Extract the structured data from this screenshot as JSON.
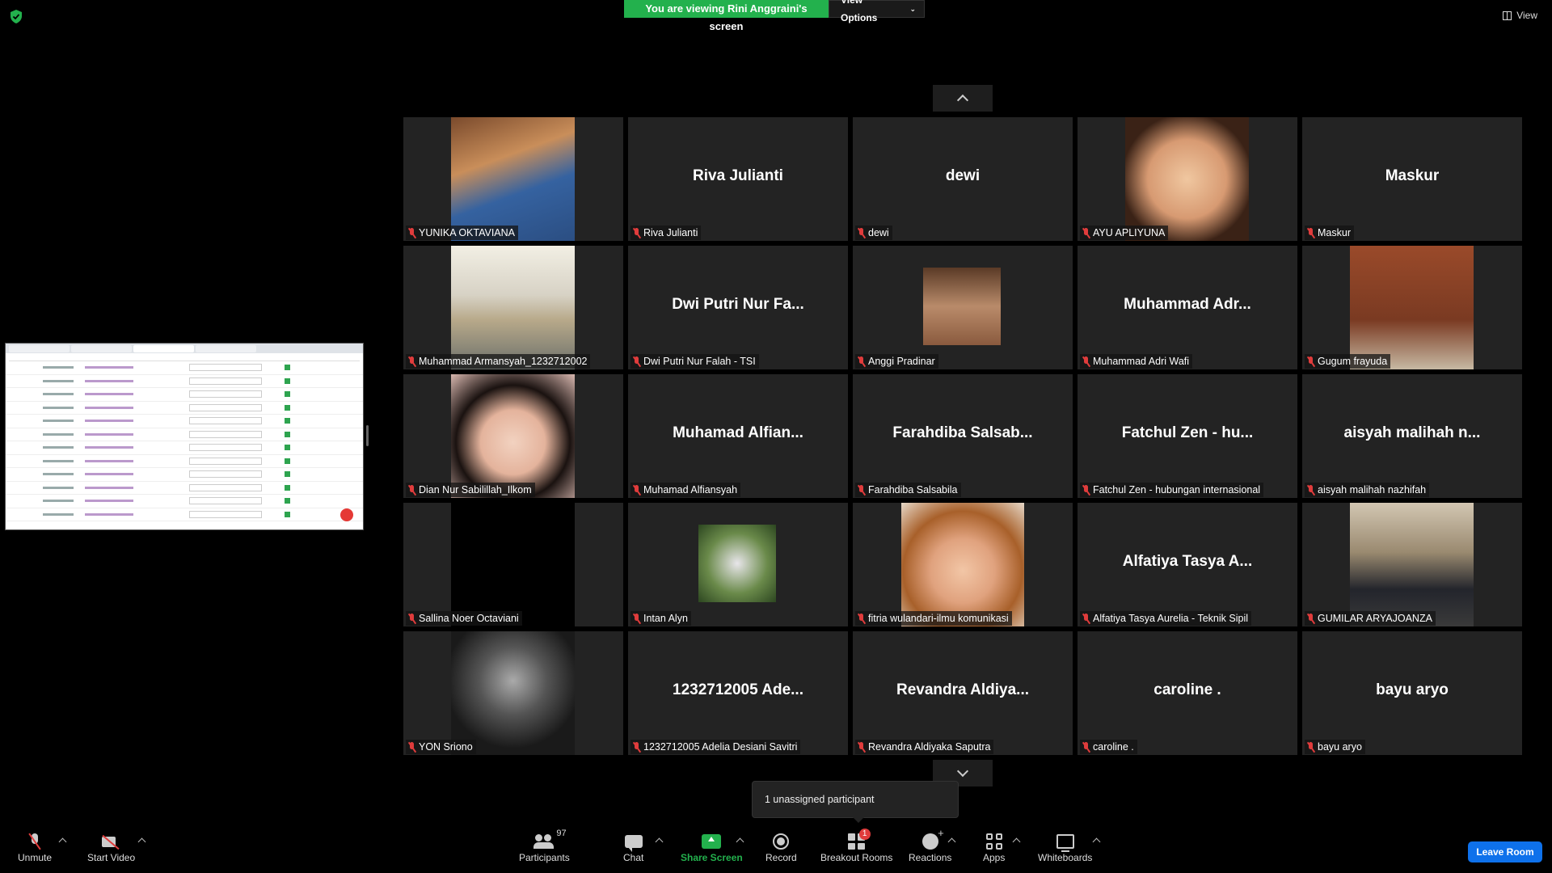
{
  "banner": {
    "viewing_text": "You are viewing Rini Anggraini's screen",
    "view_options_label": "View Options"
  },
  "view_label": "View",
  "participants": [
    {
      "display_name": "",
      "name": "YUNIKA OKTAVIANA",
      "photo": "ph1",
      "video": "full"
    },
    {
      "display_name": "Riva Julianti",
      "name": "Riva Julianti"
    },
    {
      "display_name": "dewi",
      "name": "dewi"
    },
    {
      "display_name": "",
      "name": "AYU APLIYUNA",
      "photo": "ph4",
      "video": "full"
    },
    {
      "display_name": "Maskur",
      "name": "Maskur"
    },
    {
      "display_name": "",
      "name": "Muhammad Armansyah_1232712002",
      "photo": "ph2",
      "video": "full"
    },
    {
      "display_name": "Dwi Putri Nur Fa...",
      "name": "Dwi Putri Nur Falah - TSI"
    },
    {
      "display_name": "",
      "name": "Anggi Pradinar",
      "photo": "ph3",
      "video": "small"
    },
    {
      "display_name": "Muhammad Adr...",
      "name": "Muhammad Adri Wafi"
    },
    {
      "display_name": "",
      "name": "Gugum frayuda",
      "photo": "ph5",
      "video": "full"
    },
    {
      "display_name": "",
      "name": "Dian Nur Sabilillah_Ilkom",
      "photo": "ph6",
      "video": "full"
    },
    {
      "display_name": "Muhamad Alfian...",
      "name": "Muhamad Alfiansyah"
    },
    {
      "display_name": "Farahdiba Salsab...",
      "name": "Farahdiba Salsabila"
    },
    {
      "display_name": "Fatchul Zen - hu...",
      "name": "Fatchul Zen - hubungan internasional"
    },
    {
      "display_name": "aisyah malihah n...",
      "name": "aisyah malihah nazhifah"
    },
    {
      "display_name": "",
      "name": "Sallina Noer Octaviani",
      "photo": "ph7",
      "video": "full"
    },
    {
      "display_name": "",
      "name": "Intan Alyn",
      "photo": "ph8",
      "video": "small"
    },
    {
      "display_name": "",
      "name": "fitria wulandari-ilmu komunikasi",
      "photo": "ph9",
      "video": "narrow"
    },
    {
      "display_name": "Alfatiya Tasya A...",
      "name": "Alfatiya Tasya Aurelia - Teknik Sipil"
    },
    {
      "display_name": "",
      "name": "GUMILAR ARYAJOANZA",
      "photo": "ph10",
      "video": "full"
    },
    {
      "display_name": "",
      "name": "YON Sriono",
      "photo": "ph11",
      "video": "full"
    },
    {
      "display_name": "1232712005 Ade...",
      "name": "1232712005 Adelia Desiani Savitri"
    },
    {
      "display_name": "Revandra Aldiya...",
      "name": "Revandra Aldiyaka Saputra"
    },
    {
      "display_name": "caroline .",
      "name": "caroline ."
    },
    {
      "display_name": "bayu aryo",
      "name": "bayu aryo"
    }
  ],
  "tooltip": "1 unassigned participant",
  "toolbar": {
    "unmute": "Unmute",
    "start_video": "Start Video",
    "participants": "Participants",
    "participants_count": "97",
    "chat": "Chat",
    "share_screen": "Share Screen",
    "record": "Record",
    "breakout_rooms": "Breakout Rooms",
    "breakout_badge": "1",
    "reactions": "Reactions",
    "apps": "Apps",
    "whiteboards": "Whiteboards",
    "leave_room": "Leave Room"
  },
  "colors": {
    "share_green": "#23b14d",
    "leave_blue": "#0e71eb",
    "mute_red": "#e03c3c"
  }
}
